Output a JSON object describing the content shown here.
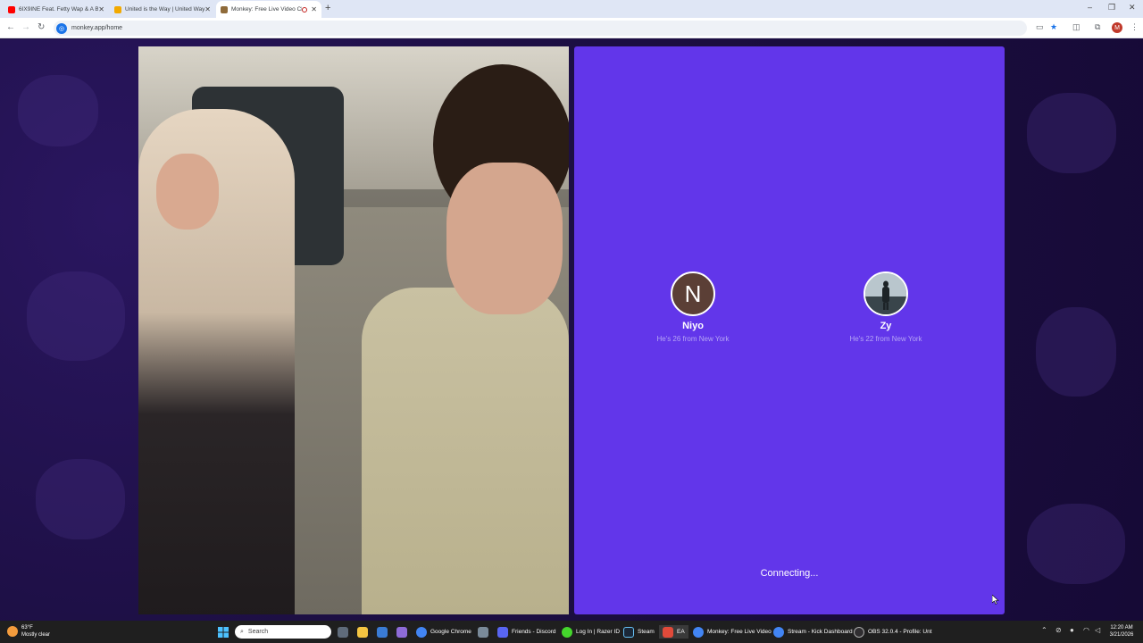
{
  "browser": {
    "tabs": [
      {
        "label": "6IX9INE Feat. Fetty Wap & A Bo",
        "favicon_color": "#ff0000",
        "active": false
      },
      {
        "label": "United is the Way | United Way",
        "favicon_color": "#f2a900",
        "active": false
      },
      {
        "label": "Monkey: Free Live Video Ch",
        "favicon_color": "#8f6b3a",
        "active": true
      }
    ],
    "new_tab": "+",
    "url": "monkey.app/home",
    "profile_initial": "M",
    "window_controls": [
      "–",
      "❐",
      "✕"
    ]
  },
  "panel": {
    "users": [
      {
        "avatar_letter": "N",
        "name": "Niyo",
        "subtitle": "He's 26 from New York",
        "avatar_color": "#5b3f36"
      },
      {
        "avatar_letter": "",
        "name": "Zy",
        "subtitle": "He's 22 from New York"
      }
    ],
    "status": "Connecting...",
    "bg_color": "#6236ea"
  },
  "taskbar": {
    "weather": {
      "temp": "63°F",
      "condition": "Mostly clear"
    },
    "search_placeholder": "Search",
    "apps": [
      {
        "label": "Google Chrome",
        "color": "#4285f4"
      },
      {
        "label": "Friends - Discord",
        "color": "#5865f2"
      },
      {
        "label": "Log In | Razer ID",
        "color": "#44d62c"
      },
      {
        "label": "Steam",
        "color": "#1b2838"
      },
      {
        "label": "EA",
        "color": "#e04a3a"
      },
      {
        "label": "Monkey: Free Live Video",
        "color": "#4285f4"
      },
      {
        "label": "Stream - Kick Dashboard",
        "color": "#4285f4"
      },
      {
        "label": "OBS 32.0.4 - Profile: Unt",
        "color": "#302e31"
      }
    ],
    "time": "12:20 AM",
    "date": "3/21/2026"
  }
}
